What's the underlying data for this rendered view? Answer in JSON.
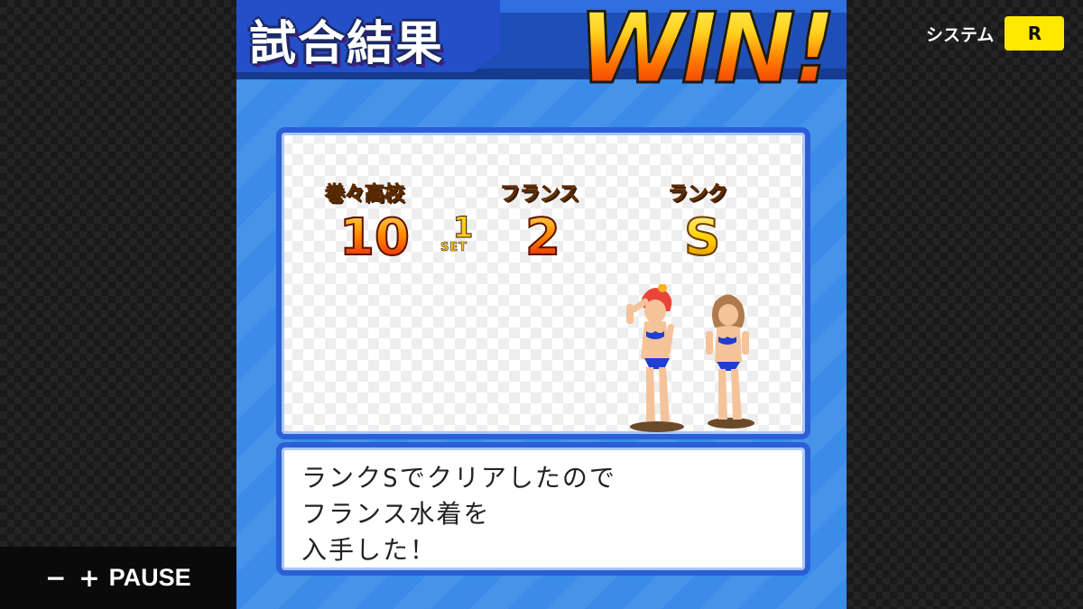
{
  "system": {
    "label": "システム",
    "button": "R"
  },
  "pause_bar": {
    "symbols": "− +",
    "label": "PAUSE"
  },
  "header": {
    "title": "試合結果",
    "win": "WIN!"
  },
  "result": {
    "team1": {
      "name": "巻々高校",
      "score": "10"
    },
    "set": {
      "number": "1",
      "label": "SET"
    },
    "team2": {
      "name": "フランス",
      "score": "2"
    },
    "rank": {
      "label": "ランク",
      "value": "S"
    }
  },
  "message": {
    "lines": [
      "ランクSでクリアしたので",
      "フランス水着を",
      "入手した！"
    ]
  },
  "colors": {
    "accent_blue": "#3b8ce8",
    "panel_border": "#2a5fd6",
    "system_button": "#ffe800"
  }
}
